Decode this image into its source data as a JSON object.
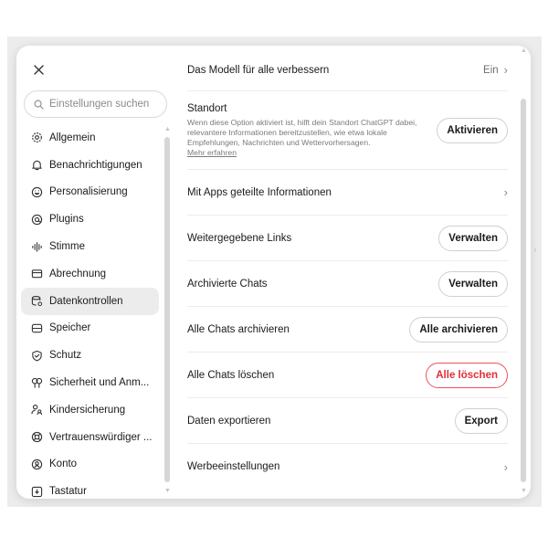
{
  "sidebar": {
    "close_label": "×",
    "search_placeholder": "Einstellungen suchen",
    "items": [
      {
        "label": "Allgemein",
        "icon": "gear-icon"
      },
      {
        "label": "Benachrichtigungen",
        "icon": "bell-icon"
      },
      {
        "label": "Personalisierung",
        "icon": "personalization-icon"
      },
      {
        "label": "Plugins",
        "icon": "plugins-icon"
      },
      {
        "label": "Stimme",
        "icon": "voice-icon"
      },
      {
        "label": "Abrechnung",
        "icon": "card-icon"
      },
      {
        "label": "Datenkontrollen",
        "icon": "database-icon",
        "active": true
      },
      {
        "label": "Speicher",
        "icon": "storage-icon"
      },
      {
        "label": "Schutz",
        "icon": "shield-icon"
      },
      {
        "label": "Sicherheit und Anm...",
        "icon": "key-icon"
      },
      {
        "label": "Kindersicherung",
        "icon": "family-icon"
      },
      {
        "label": "Vertrauenswürdiger ...",
        "icon": "lifebuoy-icon"
      },
      {
        "label": "Konto",
        "icon": "account-icon"
      },
      {
        "label": "Tastatur",
        "icon": "keyboard-icon"
      }
    ]
  },
  "content": {
    "improve_model": {
      "label": "Das Modell für alle verbessern",
      "value": "Ein",
      "chevron": "›"
    },
    "standort": {
      "title": "Standort",
      "description": "Wenn diese Option aktiviert ist, hilft dein Standort ChatGPT dabei, relevantere Informationen bereitzustellen, wie etwa lokale Empfehlungen, Nachrichten und Wettervorhersagen.",
      "link": "Mehr erfahren",
      "button": "Aktivieren"
    },
    "apps_info": {
      "label": "Mit Apps geteilte Informationen",
      "chevron": "›"
    },
    "shared_links": {
      "label": "Weitergegebene Links",
      "button": "Verwalten"
    },
    "archived_chats": {
      "label": "Archivierte Chats",
      "button": "Verwalten"
    },
    "archive_all": {
      "label": "Alle Chats archivieren",
      "button": "Alle archivieren"
    },
    "delete_all": {
      "label": "Alle Chats löschen",
      "button": "Alle löschen"
    },
    "export": {
      "label": "Daten exportieren",
      "button": "Export"
    },
    "ads": {
      "label": "Werbeeinstellungen",
      "chevron": "›"
    }
  },
  "colors": {
    "danger": "#e02e37",
    "active_bg": "#ececec"
  }
}
